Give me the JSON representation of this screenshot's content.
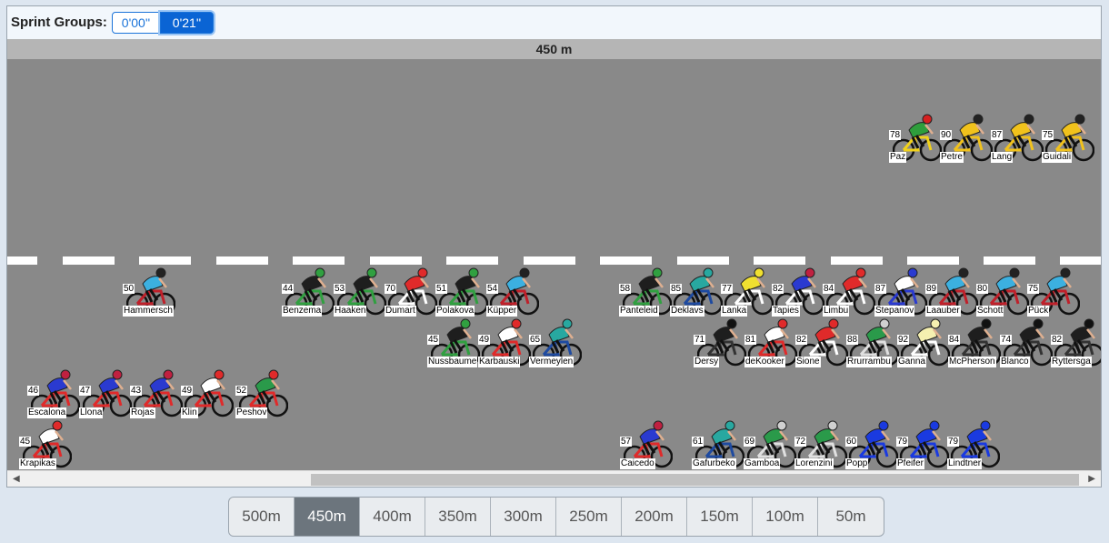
{
  "sprint_groups": {
    "label": "Sprint Groups:",
    "buttons": [
      {
        "label": "0'00''",
        "active": false
      },
      {
        "label": "0'21''",
        "active": true
      }
    ]
  },
  "distance_header": "450 m",
  "riders": [
    {
      "num": "78",
      "name": "Paz",
      "jersey": "#2e9e3c",
      "accent": "#f2d21a",
      "helmet": "#d62020"
    },
    {
      "num": "90",
      "name": "Petre",
      "jersey": "#f1c21c",
      "accent": "#f1c21c",
      "helmet": "#222222"
    },
    {
      "num": "87",
      "name": "Lang",
      "jersey": "#f1c21c",
      "accent": "#f1c21c",
      "helmet": "#222222"
    },
    {
      "num": "75",
      "name": "Guidali",
      "jersey": "#f1c21c",
      "accent": "#f1c21c",
      "helmet": "#222222"
    },
    {
      "num": "50",
      "name": "Hammersch",
      "jersey": "#3cb0e0",
      "accent": "#c0202a",
      "helmet": "#222222"
    },
    {
      "num": "44",
      "name": "Benzema",
      "jersey": "#1e1e1e",
      "accent": "#30a040",
      "helmet": "#30a040"
    },
    {
      "num": "53",
      "name": "Haaken",
      "jersey": "#1e1e1e",
      "accent": "#30a040",
      "helmet": "#30a040"
    },
    {
      "num": "70",
      "name": "Dumart",
      "jersey": "#e02a2a",
      "accent": "#ffffff",
      "helmet": "#e02a2a"
    },
    {
      "num": "51",
      "name": "Polakova",
      "jersey": "#1e1e1e",
      "accent": "#30a040",
      "helmet": "#30a040"
    },
    {
      "num": "54",
      "name": "Küpper",
      "jersey": "#3cb0e0",
      "accent": "#c0202a",
      "helmet": "#222222"
    },
    {
      "num": "58",
      "name": "Panteleid",
      "jersey": "#1e1e1e",
      "accent": "#30a040",
      "helmet": "#30a040"
    },
    {
      "num": "85",
      "name": "Deklavs",
      "jersey": "#28a8a0",
      "accent": "#1e4aa0",
      "helmet": "#28a8a0"
    },
    {
      "num": "77",
      "name": "Lanka",
      "jersey": "#f0e030",
      "accent": "#ffffff",
      "helmet": "#f0e030"
    },
    {
      "num": "82",
      "name": "Tapies",
      "jersey": "#2a3ad0",
      "accent": "#ffffff",
      "helmet": "#c02040"
    },
    {
      "num": "84",
      "name": "Limbu",
      "jersey": "#e02a2a",
      "accent": "#ffffff",
      "helmet": "#e02a2a"
    },
    {
      "num": "87",
      "name": "Stepanov",
      "jersey": "#ffffff",
      "accent": "#2a3ad0",
      "helmet": "#2a3ad0"
    },
    {
      "num": "89",
      "name": "Laauber",
      "jersey": "#3cb0e0",
      "accent": "#c0202a",
      "helmet": "#222222"
    },
    {
      "num": "80",
      "name": "Schott",
      "jersey": "#3cb0e0",
      "accent": "#c0202a",
      "helmet": "#222222"
    },
    {
      "num": "75",
      "name": "Pück",
      "jersey": "#3cb0e0",
      "accent": "#c0202a",
      "helmet": "#222222"
    },
    {
      "num": "45",
      "name": "Nussbaume",
      "jersey": "#1e1e1e",
      "accent": "#30a040",
      "helmet": "#30a040"
    },
    {
      "num": "49",
      "name": "Karbauski",
      "jersey": "#ffffff",
      "accent": "#e02a2a",
      "helmet": "#e02a2a"
    },
    {
      "num": "65",
      "name": "Vermeylen",
      "jersey": "#28a8a0",
      "accent": "#1e4aa0",
      "helmet": "#28a8a0"
    },
    {
      "num": "71",
      "name": "Dersy",
      "jersey": "#1e1e1e",
      "accent": "#333333",
      "helmet": "#111111"
    },
    {
      "num": "81",
      "name": "deKooker",
      "jersey": "#ffffff",
      "accent": "#e02a2a",
      "helmet": "#e02a2a"
    },
    {
      "num": "82",
      "name": "Sione",
      "jersey": "#e02a2a",
      "accent": "#ffffff",
      "helmet": "#e02a2a"
    },
    {
      "num": "88",
      "name": "Rrurrambu",
      "jersey": "#2a9a4a",
      "accent": "#e0e0e0",
      "helmet": "#d0d0d0"
    },
    {
      "num": "92",
      "name": "Ganna",
      "jersey": "#f5f0b0",
      "accent": "#ffffff",
      "helmet": "#f5f0b0"
    },
    {
      "num": "84",
      "name": "McPherson",
      "jersey": "#1e1e1e",
      "accent": "#333333",
      "helmet": "#111111"
    },
    {
      "num": "74",
      "name": "Blanco",
      "jersey": "#1e1e1e",
      "accent": "#333333",
      "helmet": "#111111"
    },
    {
      "num": "82",
      "name": "Ryttersga",
      "jersey": "#1e1e1e",
      "accent": "#333333",
      "helmet": "#111111"
    },
    {
      "num": "46",
      "name": "Escalona",
      "jersey": "#2a3ad0",
      "accent": "#e02a2a",
      "helmet": "#c02040"
    },
    {
      "num": "47",
      "name": "Llona",
      "jersey": "#2a3ad0",
      "accent": "#e02a2a",
      "helmet": "#c02040"
    },
    {
      "num": "43",
      "name": "Rojas",
      "jersey": "#2a3ad0",
      "accent": "#e02a2a",
      "helmet": "#c02040"
    },
    {
      "num": "49",
      "name": "Klin",
      "jersey": "#ffffff",
      "accent": "#e02a2a",
      "helmet": "#e02a2a"
    },
    {
      "num": "52",
      "name": "Peshov",
      "jersey": "#2a9a4a",
      "accent": "#e02a2a",
      "helmet": "#e02a2a"
    },
    {
      "num": "45",
      "name": "Krapikas",
      "jersey": "#ffffff",
      "accent": "#e02a2a",
      "helmet": "#e02a2a"
    },
    {
      "num": "57",
      "name": "Caicedo",
      "jersey": "#2a3ad0",
      "accent": "#e02a2a",
      "helmet": "#c02040"
    },
    {
      "num": "61",
      "name": "Gafurbeko",
      "jersey": "#28a8a0",
      "accent": "#1e4aa0",
      "helmet": "#28a8a0"
    },
    {
      "num": "69",
      "name": "Gamboa",
      "jersey": "#2a9a4a",
      "accent": "#e0e0e0",
      "helmet": "#d0d0d0"
    },
    {
      "num": "72",
      "name": "Lorenzini",
      "jersey": "#2a9a4a",
      "accent": "#e0e0e0",
      "helmet": "#d0d0d0"
    },
    {
      "num": "60",
      "name": "Popp",
      "jersey": "#1a3ae0",
      "accent": "#1a3ae0",
      "helmet": "#1a3ae0"
    },
    {
      "num": "79",
      "name": "Pfeifer",
      "jersey": "#1a3ae0",
      "accent": "#1a3ae0",
      "helmet": "#1a3ae0"
    },
    {
      "num": "79",
      "name": "Lindtner",
      "jersey": "#1a3ae0",
      "accent": "#1a3ae0",
      "helmet": "#1a3ae0"
    }
  ],
  "distance_selector": [
    {
      "label": "500m",
      "active": false
    },
    {
      "label": "450m",
      "active": true
    },
    {
      "label": "400m",
      "active": false
    },
    {
      "label": "350m",
      "active": false
    },
    {
      "label": "300m",
      "active": false
    },
    {
      "label": "250m",
      "active": false
    },
    {
      "label": "200m",
      "active": false
    },
    {
      "label": "150m",
      "active": false
    },
    {
      "label": "100m",
      "active": false
    },
    {
      "label": "50m",
      "active": false
    }
  ],
  "scroll_icons": {
    "left": "scroll-left-arrow",
    "right": "scroll-right-arrow"
  }
}
